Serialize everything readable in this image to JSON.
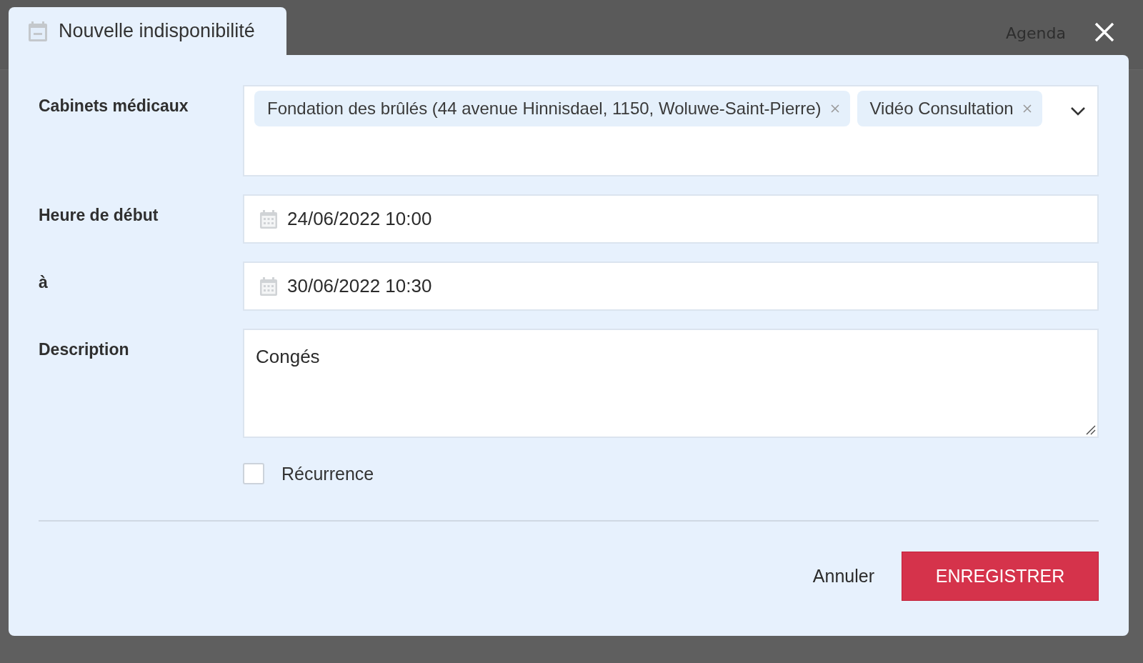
{
  "background": {
    "header_links": [
      "Agenda"
    ]
  },
  "dialog": {
    "title": "Nouvelle indisponibilité",
    "fields": [
      {
        "kind": "tags",
        "label": "Cabinets médicaux",
        "tags": [
          "Fondation des brûlés (44 avenue Hinnisdael, 1150, Woluwe-Saint-Pierre)",
          "Vidéo Consultation"
        ]
      },
      {
        "kind": "date",
        "label": "Heure de début",
        "value": "24/06/2022 10:00"
      },
      {
        "kind": "date",
        "label": "à",
        "value": "30/06/2022 10:30"
      },
      {
        "kind": "textarea",
        "label": "Description",
        "value": "Congés"
      }
    ],
    "recurrence": {
      "label": "Récurrence",
      "checked": false
    },
    "buttons": [
      {
        "label": "Annuler",
        "kind": "text"
      },
      {
        "label": "ENREGISTRER",
        "kind": "primary"
      }
    ]
  }
}
